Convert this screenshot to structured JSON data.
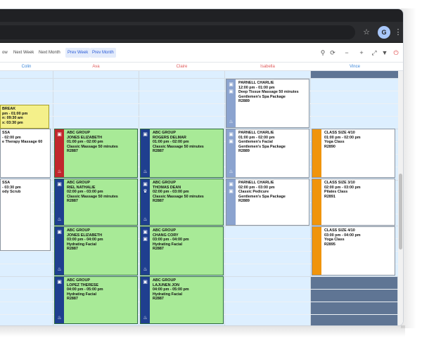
{
  "browser": {
    "profile_initial": "G",
    "star_icon": "star-icon",
    "menu_icon": "kebab-menu-icon"
  },
  "toolbar": {
    "partial_left_label": "ow",
    "next_week": "Next Week",
    "next_month": "Next Month",
    "prev_week": "Prev Week",
    "prev_month": "Prev Month",
    "icons": [
      "search-icon",
      "refresh-icon",
      "zoom-out-icon",
      "zoom-in-icon",
      "expand-icon",
      "filter-icon",
      "power-icon"
    ]
  },
  "staff": [
    "Colin",
    "Ava",
    "Claire",
    "Isabella",
    "Vince"
  ],
  "colors": {
    "green_card": "#a8ea97",
    "navy_strip": "#1f3f8f",
    "red_strip": "#c1272d",
    "orange_strip": "#f0940c",
    "steel_strip": "#8ba3cf",
    "break_yellow": "#f4f08a",
    "column_bg": "#ddefff",
    "blocked": "#5f7594",
    "staff_label": "#e05b5b",
    "staff_label_alt": "#3a86d8"
  },
  "appointments": {
    "colin_break": {
      "lines": [
        "BREAK",
        "pm - 01:00 pm",
        "n: 09:30 am",
        "x: 03:30 pm"
      ]
    },
    "colin_1": {
      "lines": [
        "SSA",
        "- 02:00 pm",
        "e Therapy Massage 60"
      ]
    },
    "colin_2": {
      "lines": [
        "SSA",
        "- 03:30 pm",
        "ody Scrub"
      ]
    },
    "ava_1": {
      "lines": [
        "ABC GROUP",
        "JONES ELIZABETH",
        "01:00 pm - 02:00 pm",
        "Classic Massage 50 minutes",
        "R2887"
      ]
    },
    "ava_2": {
      "lines": [
        "ABC GROUP",
        "RIEL NATHALIE",
        "02:00 pm - 03:00 pm",
        "Classic Massage 50 minutes",
        "R2887"
      ]
    },
    "ava_3": {
      "lines": [
        "ABC GROUP",
        "JONES ELIZABETH",
        "03:00 pm - 04:00 pm",
        "Hydrating Facial",
        "R2887"
      ]
    },
    "ava_4": {
      "lines": [
        "ABC GROUP",
        "LOPEZ THERESE",
        "04:00 pm - 05:00 pm",
        "Hydrating Facial",
        "R2887"
      ]
    },
    "claire_1": {
      "lines": [
        "ABC GROUP",
        "ROGERS DELMAR",
        "01:00 pm - 02:00 pm",
        "Classic Massage 50 minutes",
        "R2887"
      ]
    },
    "claire_2": {
      "lines": [
        "ABC GROUP",
        "THOMAS DEAN",
        "02:00 pm - 03:00 pm",
        "Classic Massage 50 minutes",
        "R2887"
      ]
    },
    "claire_3": {
      "lines": [
        "ABC GROUP",
        "CHANG CORY",
        "03:00 pm - 04:00 pm",
        "Hydrating Facial",
        "R2887"
      ]
    },
    "claire_4": {
      "lines": [
        "ABC GROUP",
        "LAJUNEN JON",
        "04:00 pm - 05:00 pm",
        "Hydrating Facial",
        "R2887"
      ]
    },
    "isabella_1": {
      "lines": [
        "PARNELL CHARLIE",
        "12:00 pm - 01:00 pm",
        "Deep Tissue Massage 50 minutes",
        "Gentlemen's Spa Package",
        "R2889"
      ]
    },
    "isabella_2": {
      "lines": [
        "PARNELL CHARLIE",
        "01:00 pm - 02:00 pm",
        "Gentlemen's Facial",
        "Gentlemen's Spa Package",
        "R2889"
      ]
    },
    "isabella_3": {
      "lines": [
        "PARNELL CHARLIE",
        "02:00 pm - 03:00 pm",
        "Classic Pedicure",
        "Gentlemen's Spa Package",
        "R2889"
      ]
    },
    "vince_1": {
      "lines": [
        "CLASS SIZE 4/10",
        "01:00 pm - 02:00 pm",
        "Yoga Class",
        "R2890"
      ]
    },
    "vince_2": {
      "lines": [
        "CLASS SIZE 3/10",
        "02:00 pm - 03:00 pm",
        "Pilates Class",
        "R2891"
      ]
    },
    "vince_3": {
      "lines": [
        "CLASS SIZE 4/10",
        "03:00 pm - 04:00 pm",
        "Yoga Class",
        "R2895"
      ]
    }
  }
}
